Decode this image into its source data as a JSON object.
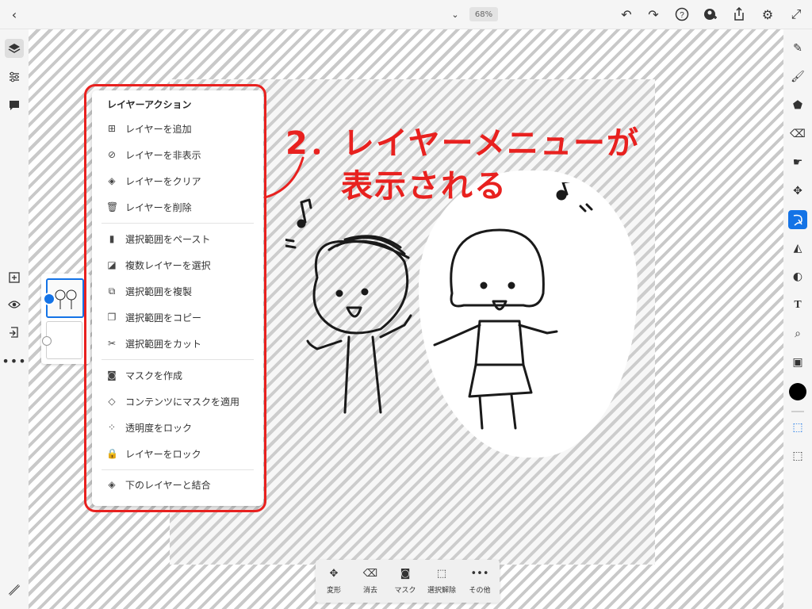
{
  "topbar": {
    "back_icon": "chevron-left-icon",
    "zoom": "68%",
    "icons": [
      "undo-icon",
      "redo-icon",
      "help-icon",
      "add-user-icon",
      "share-icon",
      "gear-icon",
      "fullscreen-icon"
    ]
  },
  "menu": {
    "title": "レイヤーアクション",
    "groups": [
      [
        {
          "label": "レイヤーを追加",
          "icon": "add-layer-icon"
        },
        {
          "label": "レイヤーを非表示",
          "icon": "eye-off-icon"
        },
        {
          "label": "レイヤーをクリア",
          "icon": "eraser-icon"
        },
        {
          "label": "レイヤーを削除",
          "icon": "trash-icon"
        }
      ],
      [
        {
          "label": "選択範囲をペースト",
          "icon": "paste-icon"
        },
        {
          "label": "複数レイヤーを選択",
          "icon": "multi-layer-icon"
        },
        {
          "label": "選択範囲を複製",
          "icon": "duplicate-icon"
        },
        {
          "label": "選択範囲をコピー",
          "icon": "copy-icon"
        },
        {
          "label": "選択範囲をカット",
          "icon": "scissors-icon"
        }
      ],
      [
        {
          "label": "マスクを作成",
          "icon": "mask-icon"
        },
        {
          "label": "コンテンツにマスクを適用",
          "icon": "apply-mask-icon"
        },
        {
          "label": "透明度をロック",
          "icon": "transparency-lock-icon"
        },
        {
          "label": "レイヤーをロック",
          "icon": "lock-icon"
        }
      ],
      [
        {
          "label": "下のレイヤーと結合",
          "icon": "merge-icon"
        }
      ]
    ]
  },
  "annotation": {
    "line1": "2．レイヤーメニューが",
    "line2": "表示される"
  },
  "bottombar": [
    {
      "label": "変形",
      "icon": "transform-icon"
    },
    {
      "label": "消去",
      "icon": "eraser-icon"
    },
    {
      "label": "マスク",
      "icon": "mask-icon"
    },
    {
      "label": "選択解除",
      "icon": "deselect-icon"
    },
    {
      "label": "その他",
      "icon": "more-icon"
    }
  ],
  "colors": {
    "accent": "#1473e6",
    "annotation": "#e8211f",
    "foreground_color": "#000000"
  }
}
